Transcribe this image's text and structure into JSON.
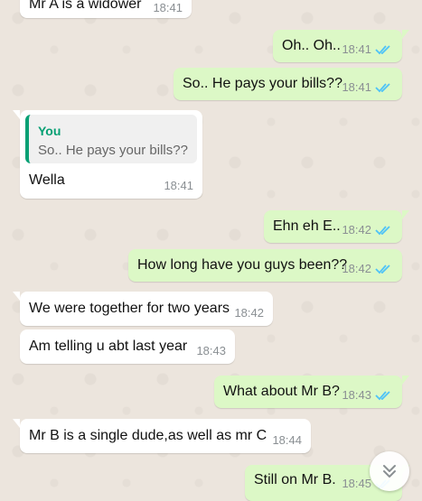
{
  "colors": {
    "incoming": "#ffffff",
    "outgoing": "#dcf8c6",
    "ticks": "#4fc3f7",
    "quote_accent": "#07a074"
  },
  "messages": [
    {
      "dir": "in",
      "text": "Mr A is a widower",
      "time": "18:41"
    },
    {
      "dir": "out",
      "text": "Oh.. Oh..",
      "time": "18:41",
      "status": "read"
    },
    {
      "dir": "out",
      "text": "So.. He pays your bills??",
      "time": "18:41",
      "status": "read"
    },
    {
      "dir": "in",
      "quote_author": "You",
      "quote_text": "So.. He pays your bills??",
      "text": "Wella",
      "time": "18:41"
    },
    {
      "dir": "out",
      "text": "Ehn eh E..",
      "time": "18:42",
      "status": "read"
    },
    {
      "dir": "out",
      "text": "How long have you guys been??",
      "time": "18:42",
      "status": "read"
    },
    {
      "dir": "in",
      "text": "We were together for two years",
      "time": "18:42"
    },
    {
      "dir": "in",
      "text": "Am telling u abt last year",
      "time": "18:43"
    },
    {
      "dir": "out",
      "text": "What about Mr B?",
      "time": "18:43",
      "status": "read"
    },
    {
      "dir": "in",
      "text": "Mr B is a single dude,as well as mr C",
      "time": "18:44"
    },
    {
      "dir": "out",
      "text": "Still on Mr B.",
      "time": "18:45",
      "status": "read"
    }
  ],
  "scroll_button": {
    "icon": "double-chevron-down-icon"
  }
}
